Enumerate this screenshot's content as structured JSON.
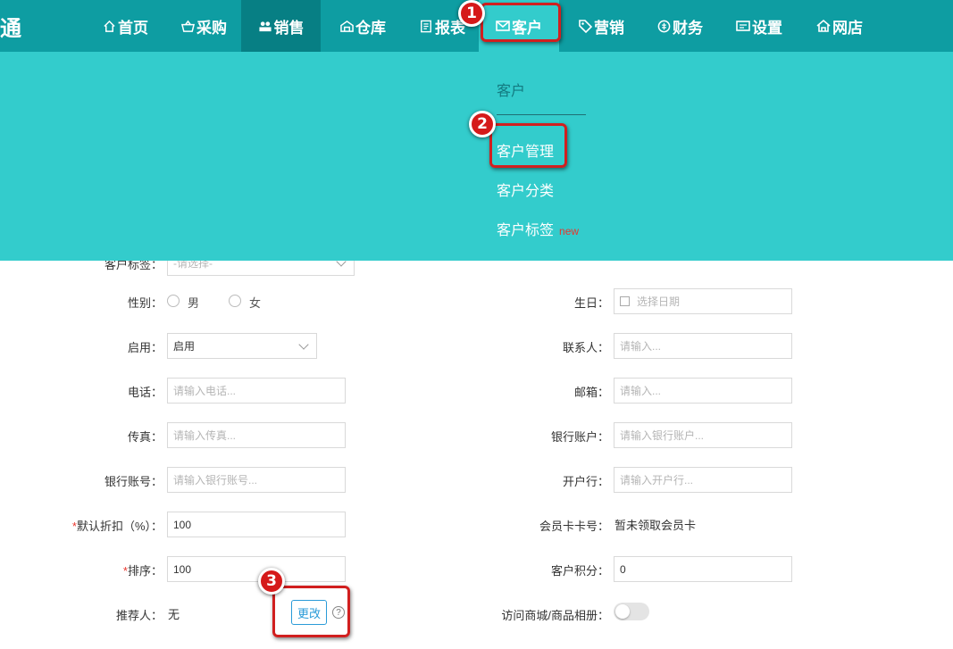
{
  "nav": {
    "logo": "通",
    "items": [
      {
        "label": "首页",
        "icon": "home-icon"
      },
      {
        "label": "采购",
        "icon": "basket-icon"
      },
      {
        "label": "销售",
        "icon": "users-icon"
      },
      {
        "label": "仓库",
        "icon": "warehouse-icon"
      },
      {
        "label": "报表",
        "icon": "report-icon"
      },
      {
        "label": "客户",
        "icon": "mail-icon"
      },
      {
        "label": "营销",
        "icon": "tag-icon"
      },
      {
        "label": "财务",
        "icon": "finance-icon"
      },
      {
        "label": "设置",
        "icon": "settings-icon"
      },
      {
        "label": "网店",
        "icon": "store-icon"
      }
    ]
  },
  "dropdown": {
    "title": "客户",
    "items": [
      "客户管理",
      "客户分类",
      "客户标签"
    ],
    "new_badge": "new"
  },
  "callouts": [
    "1",
    "2",
    "3"
  ],
  "form": {
    "tag_label": "客户标签：",
    "tag_placeholder": "-请选择-",
    "gender_label": "性别：",
    "gender_options": [
      "男",
      "女"
    ],
    "birthday_label": "生日：",
    "birthday_placeholder": "选择日期",
    "enable_label": "启用：",
    "enable_value": "启用",
    "contact_label": "联系人：",
    "contact_placeholder": "请输入...",
    "phone_label": "电话：",
    "phone_placeholder": "请输入电话...",
    "email_label": "邮箱：",
    "email_placeholder": "请输入...",
    "fax_label": "传真：",
    "fax_placeholder": "请输入传真...",
    "bank_account_label": "银行账户：",
    "bank_account_placeholder": "请输入银行账户...",
    "bank_number_label": "银行账号：",
    "bank_number_placeholder": "请输入银行账号...",
    "bank_branch_label": "开户行：",
    "bank_branch_placeholder": "请输入开户行...",
    "discount_label": "默认折扣（%）：",
    "discount_value": "100",
    "member_card_label": "会员卡卡号：",
    "member_card_value": "暂未领取会员卡",
    "sort_label": "排序：",
    "sort_value": "100",
    "points_label": "客户积分：",
    "points_value": "0",
    "referrer_label": "推荐人：",
    "referrer_value": "无",
    "change_button": "更改",
    "help_glyph": "?",
    "mall_access_label": "访问商城/商品相册：",
    "required_mark": "*"
  },
  "colors": {
    "nav_bg": "#0e9da2",
    "nav_active": "#077f84",
    "dropdown_bg": "#33cccc",
    "highlight": "#d11f1f"
  }
}
